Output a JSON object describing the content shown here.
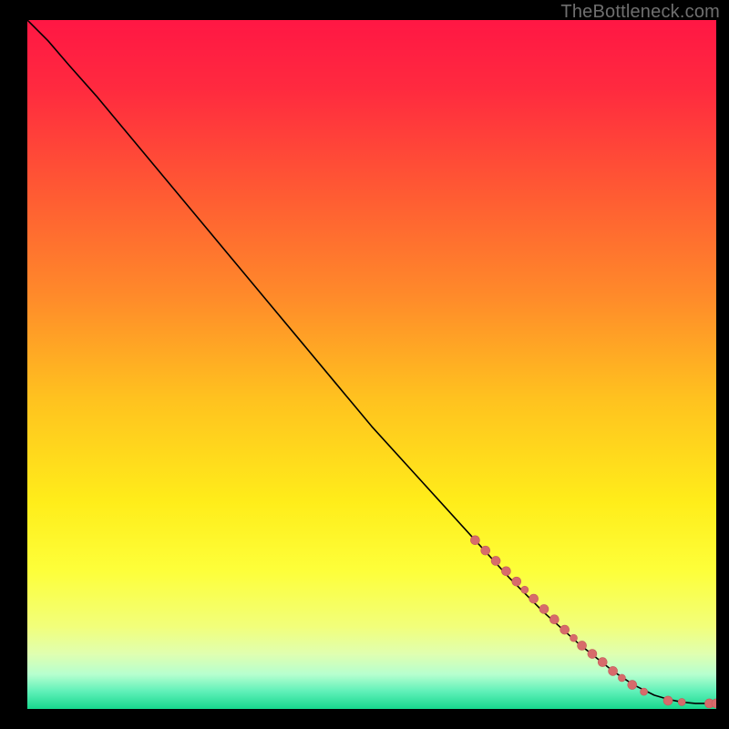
{
  "watermark": "TheBottleneck.com",
  "colors": {
    "line": "#000000",
    "marker_fill": "#d76b6b",
    "marker_stroke": "#c45a5a",
    "gradient_stops": [
      {
        "offset": 0.0,
        "color": "#ff1744"
      },
      {
        "offset": 0.1,
        "color": "#ff2a3f"
      },
      {
        "offset": 0.25,
        "color": "#ff5a33"
      },
      {
        "offset": 0.4,
        "color": "#ff8a2a"
      },
      {
        "offset": 0.55,
        "color": "#ffc21f"
      },
      {
        "offset": 0.7,
        "color": "#ffed1a"
      },
      {
        "offset": 0.8,
        "color": "#fdff3a"
      },
      {
        "offset": 0.88,
        "color": "#f2ff7a"
      },
      {
        "offset": 0.92,
        "color": "#e0ffb0"
      },
      {
        "offset": 0.95,
        "color": "#b6ffcf"
      },
      {
        "offset": 0.975,
        "color": "#5ef0b8"
      },
      {
        "offset": 1.0,
        "color": "#17d88d"
      }
    ]
  },
  "chart_data": {
    "type": "line",
    "title": "",
    "xlabel": "",
    "ylabel": "",
    "xlim": [
      0,
      100
    ],
    "ylim": [
      0,
      100
    ],
    "legend": false,
    "grid": false,
    "series": [
      {
        "name": "curve",
        "x": [
          0,
          3,
          6,
          10,
          15,
          20,
          25,
          30,
          35,
          40,
          45,
          50,
          55,
          60,
          65,
          70,
          75,
          80,
          85,
          88,
          91,
          93,
          95,
          97,
          99,
          100
        ],
        "y": [
          100,
          97,
          93.5,
          89,
          83,
          77,
          71,
          65,
          59,
          53,
          47,
          41,
          35.5,
          30,
          24.5,
          19,
          14,
          9.5,
          5.5,
          3.5,
          2.0,
          1.4,
          1.0,
          0.8,
          0.8,
          0.8
        ]
      }
    ],
    "markers": [
      {
        "x": 65.0,
        "y": 24.5,
        "r": 5
      },
      {
        "x": 66.5,
        "y": 23.0,
        "r": 5
      },
      {
        "x": 68.0,
        "y": 21.5,
        "r": 5
      },
      {
        "x": 69.5,
        "y": 20.0,
        "r": 5
      },
      {
        "x": 71.0,
        "y": 18.5,
        "r": 5
      },
      {
        "x": 72.2,
        "y": 17.3,
        "r": 4
      },
      {
        "x": 73.5,
        "y": 16.0,
        "r": 5
      },
      {
        "x": 75.0,
        "y": 14.5,
        "r": 5
      },
      {
        "x": 76.5,
        "y": 13.0,
        "r": 5
      },
      {
        "x": 78.0,
        "y": 11.5,
        "r": 5
      },
      {
        "x": 79.3,
        "y": 10.3,
        "r": 4
      },
      {
        "x": 80.5,
        "y": 9.2,
        "r": 5
      },
      {
        "x": 82.0,
        "y": 8.0,
        "r": 5
      },
      {
        "x": 83.5,
        "y": 6.8,
        "r": 5
      },
      {
        "x": 85.0,
        "y": 5.5,
        "r": 5
      },
      {
        "x": 86.3,
        "y": 4.5,
        "r": 4
      },
      {
        "x": 87.8,
        "y": 3.5,
        "r": 5
      },
      {
        "x": 89.5,
        "y": 2.5,
        "r": 4
      },
      {
        "x": 93.0,
        "y": 1.2,
        "r": 5
      },
      {
        "x": 95.0,
        "y": 1.0,
        "r": 4
      },
      {
        "x": 99.0,
        "y": 0.8,
        "r": 5
      },
      {
        "x": 100.0,
        "y": 0.8,
        "r": 5
      }
    ]
  }
}
